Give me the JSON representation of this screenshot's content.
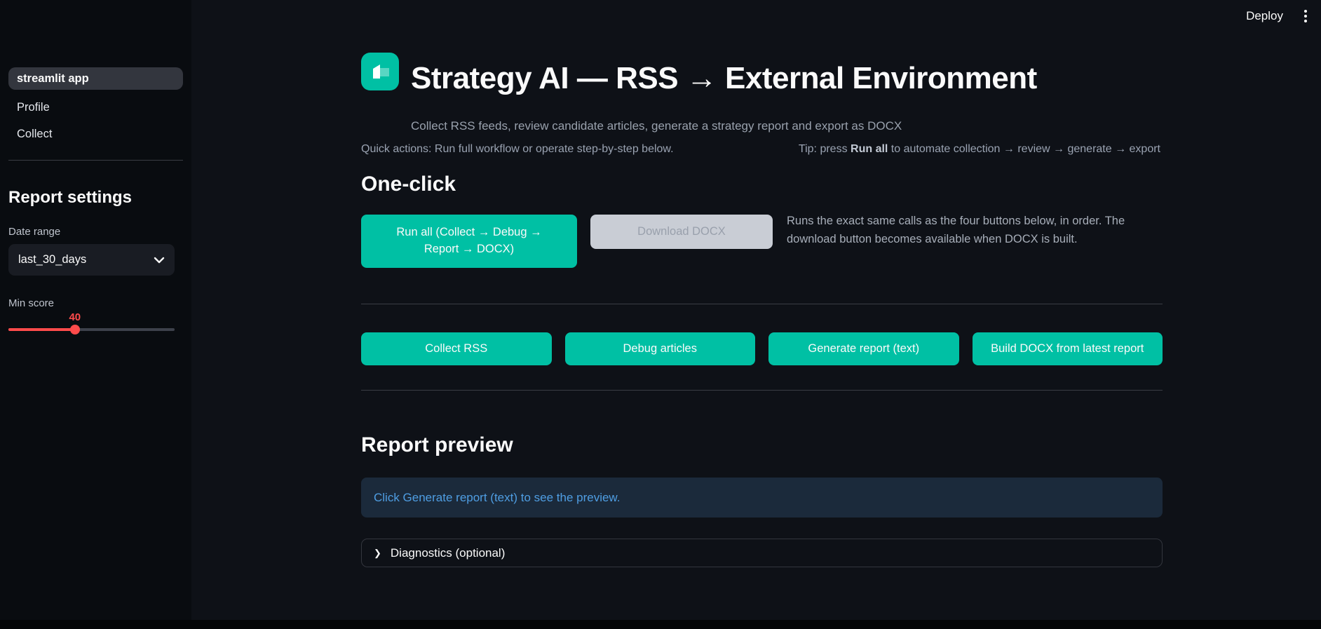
{
  "topbar": {
    "deploy_label": "Deploy"
  },
  "sidebar": {
    "nav": [
      {
        "label": "streamlit app",
        "active": true
      },
      {
        "label": "Profile",
        "active": false
      },
      {
        "label": "Collect",
        "active": false
      }
    ],
    "settings": {
      "heading": "Report settings",
      "date_range": {
        "label": "Date range",
        "value": "last_30_days"
      },
      "min_score": {
        "label": "Min score",
        "value": "40",
        "percent": 40
      }
    }
  },
  "header": {
    "title": "Strategy AI — RSS → External Environment",
    "subtitle": "Collect RSS feeds, review candidate articles, generate a strategy report and export as DOCX",
    "quick_actions": "Quick actions: Run full workflow or operate step-by-step below.",
    "tip_prefix": "Tip: press ",
    "tip_bold": "Run all",
    "tip_suffix": " to automate collection → review → generate → export"
  },
  "one_click": {
    "heading": "One-click",
    "run_all_label": "Run all (Collect → Debug → Report → DOCX)",
    "download_label": "Download DOCX",
    "description": "Runs the exact same calls as the four buttons below, in order. The download button becomes available when DOCX is built."
  },
  "step_buttons": [
    {
      "label": "Collect RSS"
    },
    {
      "label": "Debug articles"
    },
    {
      "label": "Generate report (text)"
    },
    {
      "label": "Build DOCX from latest report"
    }
  ],
  "report_preview": {
    "heading": "Report preview",
    "info_message": "Click Generate report (text) to see the preview."
  },
  "diagnostics": {
    "label": "Diagnostics (optional)"
  },
  "colors": {
    "primary_teal": "#00c0a4",
    "slider_red": "#ff4b4b",
    "info_blue": "#4f9ee3",
    "disabled_button_bg": "#c9cdd5",
    "main_background": "#0e1117",
    "sidebar_background": "#090c10"
  }
}
